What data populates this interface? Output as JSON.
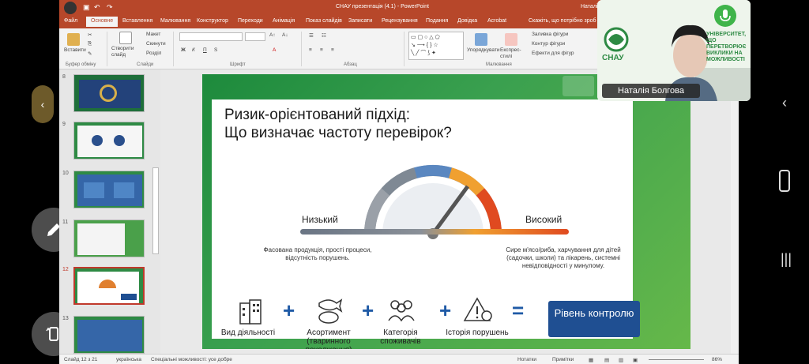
{
  "window": {
    "title": "СНАУ презентація (4.1) - PowerPoint",
    "user": "Наталія Вікторівна Болгова"
  },
  "tabs": [
    "Основне",
    "Вставлення",
    "Малювання",
    "Конструктор",
    "Переходи",
    "Анімація",
    "Показ слайдів",
    "Записати",
    "Рецензування",
    "Подання",
    "Довідка",
    "Acrobat"
  ],
  "tell_me": "Скажіть, що потрібно зроб",
  "ribbon": {
    "paste": "Вставити",
    "new_slide": "Створити слайд",
    "layout": "Макет",
    "reset": "Скинути",
    "section": "Розділ",
    "arrange": "Упорядкувати",
    "quick_styles": "Експрес-стилі",
    "shape_fill": "Заливка фігури",
    "shape_outline": "Контур фігури",
    "shape_effects": "Ефекти для фігур",
    "groups": {
      "clipboard": "Буфер обміну",
      "slides": "Слайди",
      "font": "Шрифт",
      "paragraph": "Абзац",
      "drawing": "Малювання"
    }
  },
  "thumbnails": [
    {
      "num": "8"
    },
    {
      "num": "9"
    },
    {
      "num": "10"
    },
    {
      "num": "11"
    },
    {
      "num": "12"
    },
    {
      "num": "13"
    }
  ],
  "slide": {
    "title_line1": "Ризик-орієнтований підхід:",
    "title_line2": "Що визначає частоту перевірок?",
    "low": "Низький",
    "high": "Високий",
    "low_desc": "Фасована продукція, прості процеси, відсутність порушень.",
    "high_desc": "Сире м'ясо/риба, харчування для дітей (садочки, школи) та лікарень, системні невідповідності у минулому.",
    "factors": [
      "Вид діяльності",
      "Асортимент (тваринного походження)",
      "Категорія споживачів",
      "Історія порушень"
    ],
    "plus": "+",
    "equals": "=",
    "result": "Рівень контролю"
  },
  "statusbar": {
    "slide": "Слайд 12 з 21",
    "language": "українська",
    "accessibility": "Спеціальні можливості: усе добре",
    "notes": "Нотатки",
    "comments": "Примітки",
    "zoom": "86%"
  },
  "video": {
    "name": "Наталія Болгова",
    "logo": "СНАУ",
    "banner": "УНІВЕРСИТЕТ, ЩО ПЕРЕТВОРЮЄ ВИКЛИКИ НА МОЖЛИВОСТІ"
  },
  "colors": {
    "accent": "#b7472a",
    "slide_green": "#2f9a45",
    "control_blue": "#1f4f92"
  }
}
